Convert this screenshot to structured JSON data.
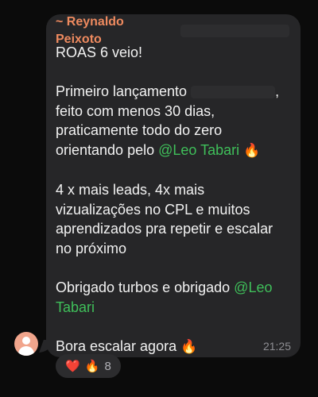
{
  "chat": {
    "sender": "~ Reynaldo Peixoto",
    "lines": [
      "ROAS 6 veio!",
      "",
      "Primeiro lançamento",
      "feito com menos 30 dias,",
      "praticamente todo do zero",
      "orientando pelo",
      "",
      "4 x mais leads, 4x mais",
      "vizualizações no CPL e muitos",
      "aprendizados pra repetir e escalar",
      "no próximo",
      "",
      "Obrigado turbos e obrigado",
      "",
      "Bora escalar agora"
    ],
    "mention_1": "@Leo Tabari",
    "mention_2a": "@Leo",
    "mention_2b": "Tabari",
    "fire_emoji": "🔥",
    "time": "21:25"
  },
  "reactions": {
    "heart": "❤️",
    "fire": "🔥",
    "count": "8"
  },
  "icons": {
    "avatar": "person-placeholder-icon"
  },
  "colors": {
    "bubble": "#262628",
    "sender": "#ee8a5f",
    "mention": "#3fbf5a",
    "text": "#f2f2f2",
    "time": "#8e8e93"
  }
}
